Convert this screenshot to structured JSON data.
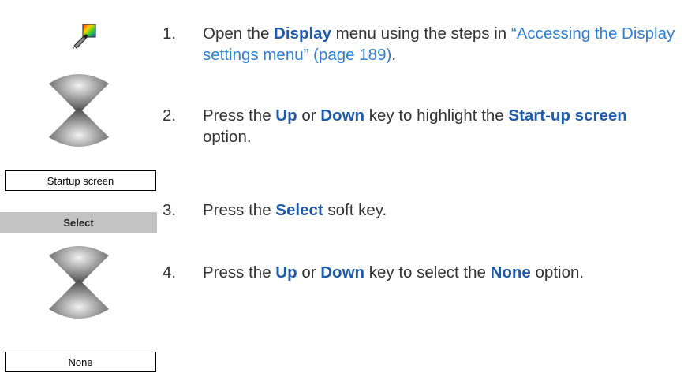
{
  "icons": {
    "display_settings": "paintbrush-color-palette-icon",
    "navigation_key": "up-down-navigation-key-icon"
  },
  "screens": {
    "startup_label": "Startup screen",
    "softkey_label": "Select",
    "none_label": "None"
  },
  "steps": [
    {
      "number": "1.",
      "parts": [
        "Open the ",
        "Display",
        " menu using the steps in ",
        "“Accessing the Display settings menu” (page 189)",
        "."
      ]
    },
    {
      "number": "2.",
      "parts": [
        "Press the ",
        "Up",
        " or ",
        "Down",
        " key to highlight the ",
        "Start-up screen",
        " option."
      ]
    },
    {
      "number": "3.",
      "parts": [
        "Press the ",
        "Select",
        " soft key."
      ]
    },
    {
      "number": "4.",
      "parts": [
        "Press the ",
        "Up",
        " or ",
        "Down",
        " key to select the ",
        "None",
        " option."
      ]
    }
  ],
  "colors": {
    "keyword": "#1f5ba8",
    "link": "#2e7fd0",
    "softkey_background": "#c3c3c3"
  }
}
